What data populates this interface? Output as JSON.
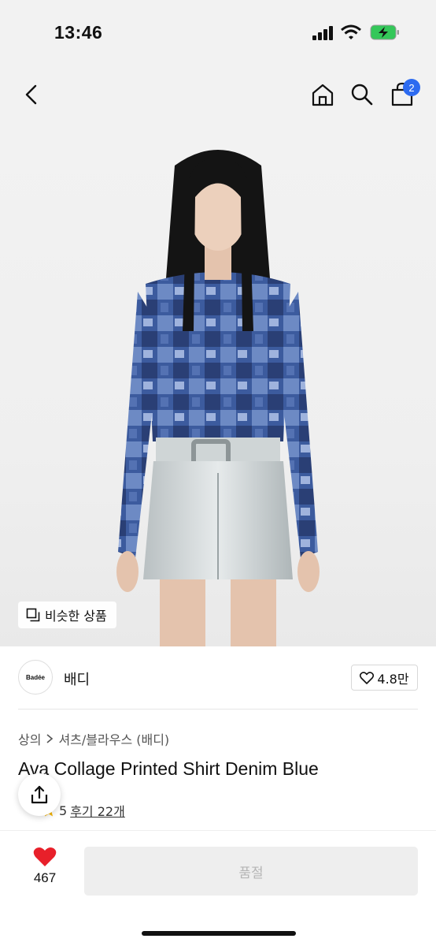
{
  "status_bar": {
    "time": "13:46"
  },
  "header": {
    "cart_count": "2"
  },
  "hero": {
    "similar_label": "비슷한 상품"
  },
  "brand": {
    "logo_text": "Badée",
    "name": "배디",
    "likes": "4.8만"
  },
  "breadcrumb": {
    "category": "상의",
    "subcategory": "셔츠/블라우스 (배디)"
  },
  "product": {
    "title": "Ava Collage Printed Shirt Denim Blue",
    "rating_partial": "5",
    "review_label": "후기 22개"
  },
  "bottom": {
    "wish_count": "467",
    "buy_label": "품절"
  },
  "colors": {
    "accent": "#2d6bf0",
    "heart": "#e8202a",
    "disabled": "#eeeeee"
  }
}
